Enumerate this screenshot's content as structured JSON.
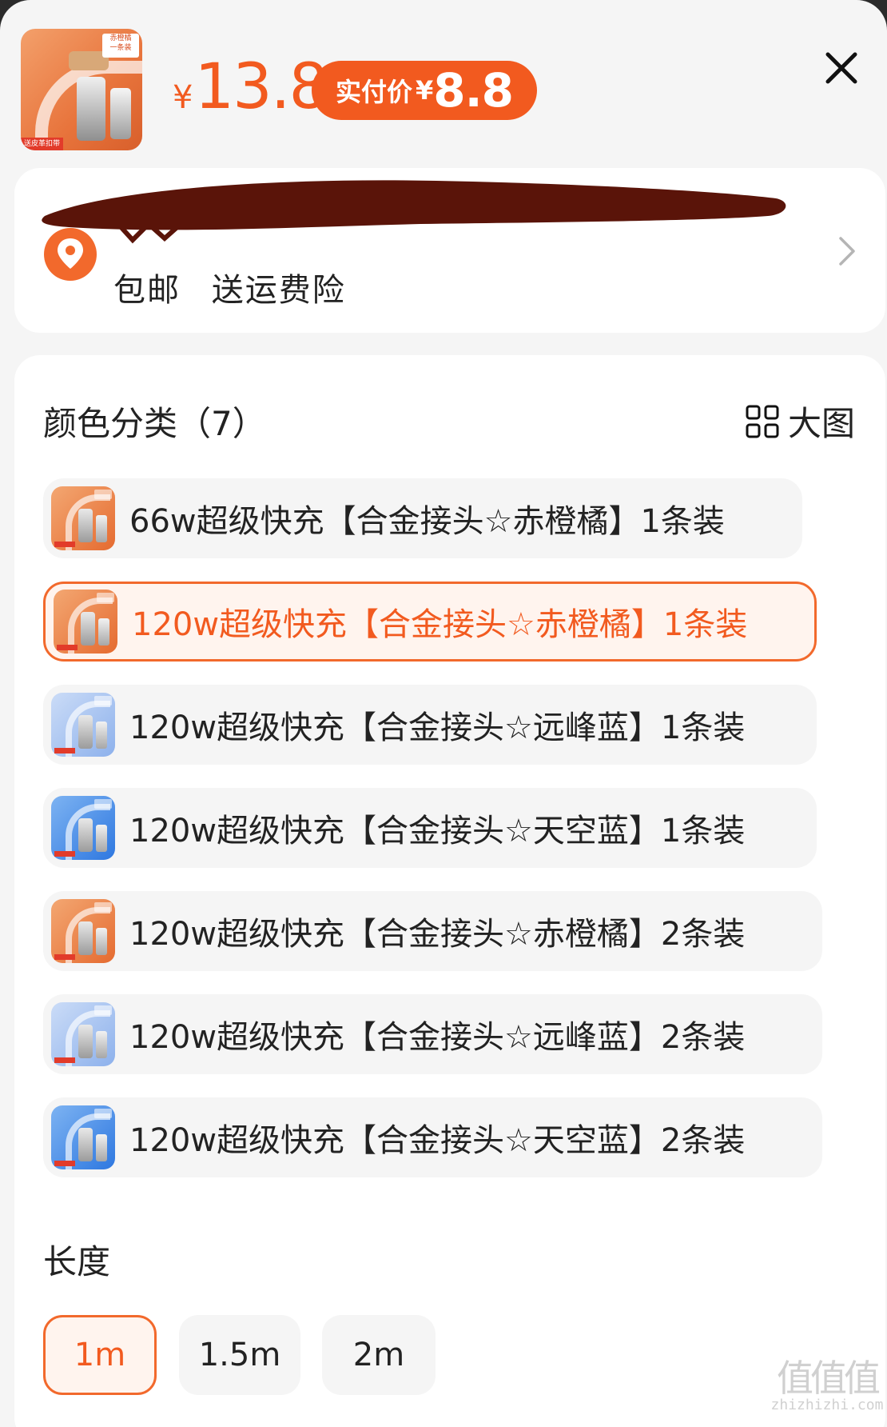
{
  "header": {
    "price_symbol": "¥",
    "price": "13.8",
    "pay_label": "实付价",
    "pay_symbol": "¥",
    "pay_price": "8.8",
    "thumb_tag": "赤橙橘\n一条装",
    "thumb_foot": "送皮革扣带"
  },
  "address": {
    "shipping": [
      "包邮",
      "送运费险"
    ]
  },
  "color_section": {
    "title": "颜色分类（7）",
    "big_view_label": "大图",
    "variants": [
      {
        "label": "66w超级快充【合金接头☆赤橙橘】1条装",
        "color": "orange",
        "selected": false
      },
      {
        "label": "120w超级快充【合金接头☆赤橙橘】1条装",
        "color": "orange",
        "selected": true
      },
      {
        "label": "120w超级快充【合金接头☆远峰蓝】1条装",
        "color": "ltblue",
        "selected": false
      },
      {
        "label": "120w超级快充【合金接头☆天空蓝】1条装",
        "color": "blue",
        "selected": false
      },
      {
        "label": "120w超级快充【合金接头☆赤橙橘】2条装",
        "color": "orange",
        "selected": false
      },
      {
        "label": "120w超级快充【合金接头☆远峰蓝】2条装",
        "color": "ltblue",
        "selected": false
      },
      {
        "label": "120w超级快充【合金接头☆天空蓝】2条装",
        "color": "blue",
        "selected": false
      }
    ]
  },
  "length_section": {
    "title": "长度",
    "options": [
      {
        "label": "1m",
        "selected": true
      },
      {
        "label": "1.5m",
        "selected": false
      },
      {
        "label": "2m",
        "selected": false
      }
    ]
  },
  "watermark": {
    "big": "值值值",
    "small": "zhizhizhi.com"
  },
  "colors": {
    "accent": "#f25a1f",
    "selected_bg": "#fff4ee",
    "chip_bg": "#f5f5f5"
  }
}
